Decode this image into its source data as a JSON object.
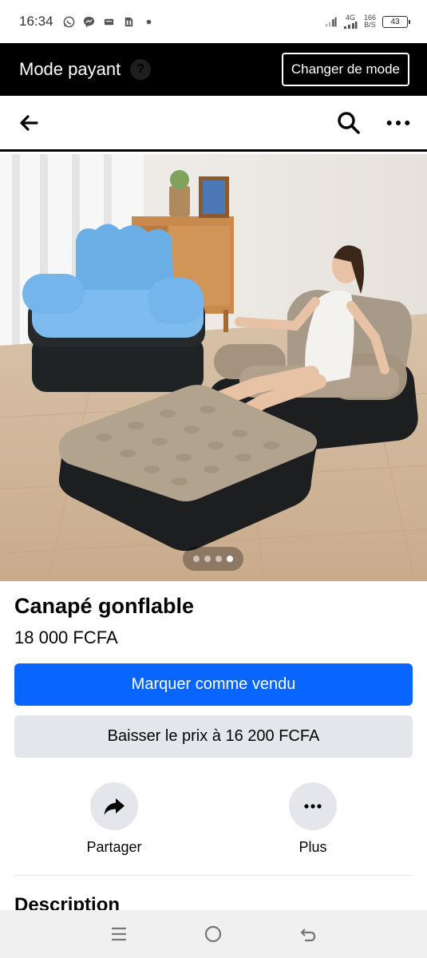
{
  "status_bar": {
    "time": "16:34",
    "notification_icons": [
      "whatsapp-icon",
      "messenger-icon",
      "message-icon",
      "sim-icon",
      "dot-icon"
    ],
    "network": "4G",
    "speed_value": "166",
    "speed_unit": "B/S",
    "battery": "43"
  },
  "mode_bar": {
    "title": "Mode payant",
    "help_icon": "?",
    "button_label": "Changer de mode"
  },
  "header": {
    "back_icon": "arrow-left-icon",
    "search_icon": "search-icon",
    "more_icon": "more-horizontal-icon"
  },
  "photo": {
    "carousel_count": 4,
    "carousel_active_index": 3
  },
  "listing": {
    "title": "Canapé gonflable",
    "price": "18 000 FCFA",
    "primary_button": "Marquer comme vendu",
    "secondary_button": "Baisser le prix à 16 200 FCFA"
  },
  "actions": [
    {
      "label": "Partager",
      "icon": "share-icon"
    },
    {
      "label": "Plus",
      "icon": "more-horizontal-icon"
    }
  ],
  "description_title": "Description",
  "system_nav": [
    "recents-icon",
    "home-icon",
    "back-icon"
  ],
  "colors": {
    "primary": "#0866ff",
    "secondary": "#e4e6eb",
    "mode_bar": "#000000"
  }
}
